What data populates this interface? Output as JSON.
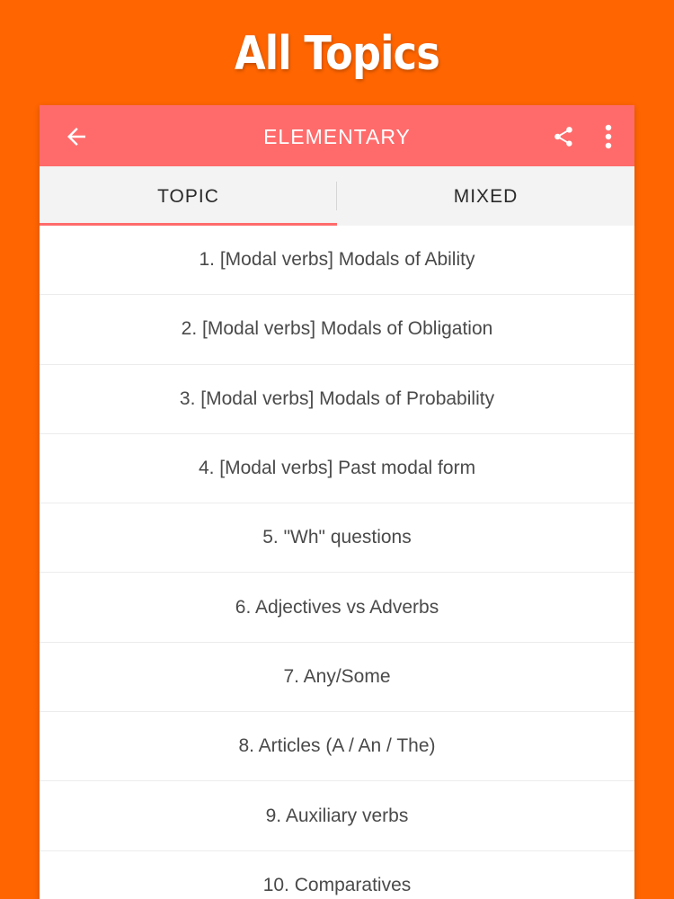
{
  "headline": "All Topics",
  "appbar": {
    "title": "ELEMENTARY",
    "back_icon": "arrow-left-icon",
    "share_icon": "share-icon",
    "more_icon": "more-vertical-icon",
    "color": "#ff6b6b"
  },
  "tabs": [
    {
      "label": "TOPIC",
      "active": true
    },
    {
      "label": "MIXED",
      "active": false
    }
  ],
  "topics": [
    "1. [Modal verbs] Modals of Ability",
    "2. [Modal verbs] Modals of Obligation",
    "3. [Modal verbs] Modals of Probability",
    "4. [Modal verbs] Past modal form",
    "5. \"Wh\" questions",
    "6. Adjectives vs Adverbs",
    "7. Any/Some",
    "8. Articles (A / An / The)",
    "9. Auxiliary verbs",
    "10. Comparatives"
  ],
  "colors": {
    "background": "#ff6500",
    "accent": "#ff6b6b"
  }
}
